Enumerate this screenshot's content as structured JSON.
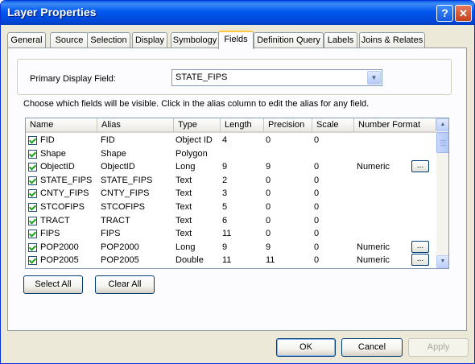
{
  "window": {
    "title": "Layer Properties",
    "help_icon": "?",
    "close_icon": "✕"
  },
  "tabs": [
    {
      "label": "General"
    },
    {
      "label": "Source"
    },
    {
      "label": "Selection"
    },
    {
      "label": "Display"
    },
    {
      "label": "Symbology"
    },
    {
      "label": "Fields",
      "active": true
    },
    {
      "label": "Definition Query"
    },
    {
      "label": "Labels"
    },
    {
      "label": "Joins & Relates"
    }
  ],
  "primary_display": {
    "label": "Primary Display Field:",
    "value": "STATE_FIPS"
  },
  "instructions": "Choose which fields will be visible. Click in the alias column to edit the alias for any field.",
  "fields_table": {
    "columns": [
      "Name",
      "Alias",
      "Type",
      "Length",
      "Precision",
      "Scale",
      "Number Format"
    ],
    "rows": [
      {
        "name": "FID",
        "alias": "FID",
        "type": "Object ID",
        "length": "4",
        "precision": "0",
        "scale": "0",
        "format": "",
        "checked": true,
        "has_button": false
      },
      {
        "name": "Shape",
        "alias": "Shape",
        "type": "Polygon",
        "length": "",
        "precision": "",
        "scale": "",
        "format": "",
        "checked": true,
        "has_button": false
      },
      {
        "name": "ObjectID",
        "alias": "ObjectID",
        "type": "Long",
        "length": "9",
        "precision": "9",
        "scale": "0",
        "format": "Numeric",
        "checked": true,
        "has_button": true
      },
      {
        "name": "STATE_FIPS",
        "alias": "STATE_FIPS",
        "type": "Text",
        "length": "2",
        "precision": "0",
        "scale": "0",
        "format": "",
        "checked": true,
        "has_button": false
      },
      {
        "name": "CNTY_FIPS",
        "alias": "CNTY_FIPS",
        "type": "Text",
        "length": "3",
        "precision": "0",
        "scale": "0",
        "format": "",
        "checked": true,
        "has_button": false
      },
      {
        "name": "STCOFIPS",
        "alias": "STCOFIPS",
        "type": "Text",
        "length": "5",
        "precision": "0",
        "scale": "0",
        "format": "",
        "checked": true,
        "has_button": false
      },
      {
        "name": "TRACT",
        "alias": "TRACT",
        "type": "Text",
        "length": "6",
        "precision": "0",
        "scale": "0",
        "format": "",
        "checked": true,
        "has_button": false
      },
      {
        "name": "FIPS",
        "alias": "FIPS",
        "type": "Text",
        "length": "11",
        "precision": "0",
        "scale": "0",
        "format": "",
        "checked": true,
        "has_button": false
      },
      {
        "name": "POP2000",
        "alias": "POP2000",
        "type": "Long",
        "length": "9",
        "precision": "9",
        "scale": "0",
        "format": "Numeric",
        "checked": true,
        "has_button": true
      },
      {
        "name": "POP2005",
        "alias": "POP2005",
        "type": "Double",
        "length": "11",
        "precision": "11",
        "scale": "0",
        "format": "Numeric",
        "checked": true,
        "has_button": true
      }
    ],
    "ellipsis_label": "..."
  },
  "buttons": {
    "select_all": "Select All",
    "clear_all": "Clear All",
    "ok": "OK",
    "cancel": "Cancel",
    "apply": "Apply"
  },
  "scrollbar": {
    "up_icon": "▲",
    "down_icon": "▼"
  },
  "colors": {
    "titlebar": "#0058EE",
    "active_tab_highlight": "#FFC83C",
    "dialog_bg": "#ECE9D8"
  }
}
